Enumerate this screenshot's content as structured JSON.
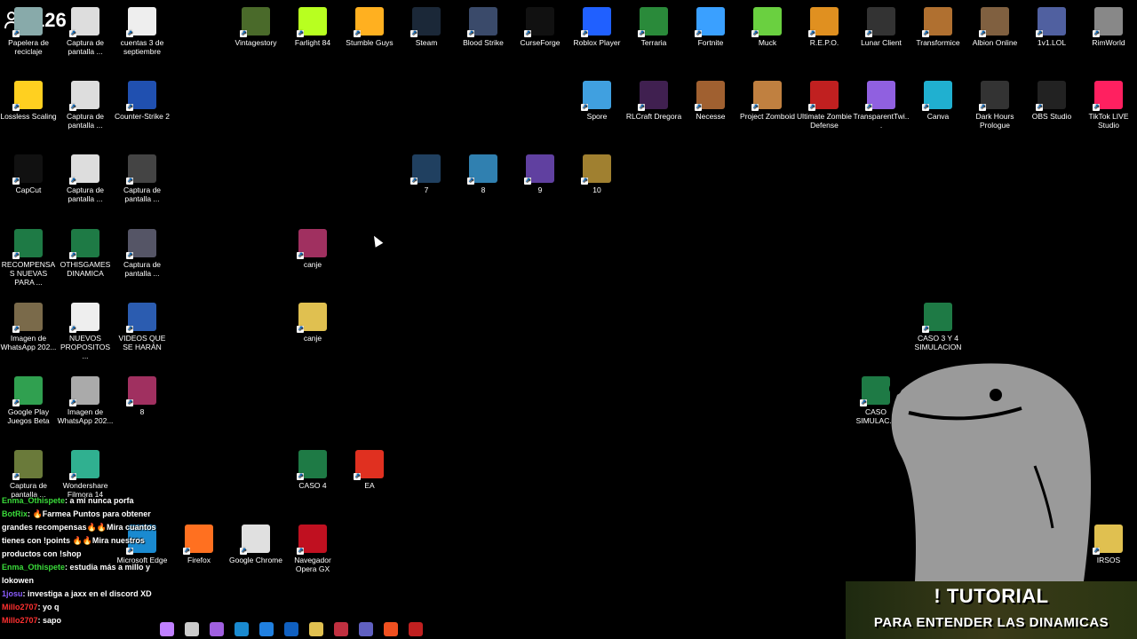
{
  "stream": {
    "viewer_count": "126",
    "banner_line1": "! TUTORIAL",
    "banner_line2": "PARA ENTENDER LAS DINAMICAS"
  },
  "desktop_icons": [
    {
      "label": "Papelera de reciclaje",
      "icon": "recycle-bin-icon",
      "color": "#8aa"
    },
    {
      "label": "Captura de pantalla ...",
      "icon": "screenshot-icon",
      "color": "#ddd"
    },
    {
      "label": "cuentas 3 de septiembre",
      "icon": "document-icon",
      "color": "#eee"
    },
    {
      "label": "Vintagestory",
      "icon": "tree-icon",
      "color": "#4a6a2a"
    },
    {
      "label": "Farlight 84",
      "icon": "farlight-icon",
      "color": "#b8ff20"
    },
    {
      "label": "Stumble Guys",
      "icon": "stumble-icon",
      "color": "#ffb020"
    },
    {
      "label": "Steam",
      "icon": "steam-icon",
      "color": "#1b2838"
    },
    {
      "label": "Blood Strike",
      "icon": "blood-strike-icon",
      "color": "#3a4a6a"
    },
    {
      "label": "CurseForge",
      "icon": "anvil-icon",
      "color": "#111"
    },
    {
      "label": "Roblox Player",
      "icon": "roblox-icon",
      "color": "#2060ff"
    },
    {
      "label": "Terraria",
      "icon": "terraria-icon",
      "color": "#2a8a3a"
    },
    {
      "label": "Fortnite",
      "icon": "fortnite-icon",
      "color": "#3aa0ff"
    },
    {
      "label": "Muck",
      "icon": "muck-icon",
      "color": "#6ad040"
    },
    {
      "label": "R.E.P.O.",
      "icon": "repo-icon",
      "color": "#e09020"
    },
    {
      "label": "Lunar Client",
      "icon": "lunar-icon",
      "color": "#333"
    },
    {
      "label": "Transformice",
      "icon": "mouse-icon",
      "color": "#b07030"
    },
    {
      "label": "Albion Online",
      "icon": "albion-icon",
      "color": "#806040"
    },
    {
      "label": "1v1.LOL",
      "icon": "1v1-icon",
      "color": "#5060a0"
    },
    {
      "label": "RimWorld",
      "icon": "rimworld-icon",
      "color": "#888"
    },
    {
      "label": "Lossless Scaling",
      "icon": "duck-icon",
      "color": "#ffd020"
    },
    {
      "label": "Captura de pantalla ...",
      "icon": "screenshot-icon",
      "color": "#ddd"
    },
    {
      "label": "Counter-Strike 2",
      "icon": "cs2-icon",
      "color": "#2050b0"
    },
    {
      "label": "Spore",
      "icon": "spore-icon",
      "color": "#40a0e0"
    },
    {
      "label": "RLCraft Dregora",
      "icon": "rlcraft-icon",
      "color": "#402050"
    },
    {
      "label": "Necesse",
      "icon": "necesse-icon",
      "color": "#a06030"
    },
    {
      "label": "Project Zomboid",
      "icon": "zomboid-icon",
      "color": "#c08040"
    },
    {
      "label": "Ultimate Zombie Defense",
      "icon": "uzd-icon",
      "color": "#c02020"
    },
    {
      "label": "TransparentTwi...",
      "icon": "chat-bubble-icon",
      "color": "#9060e0"
    },
    {
      "label": "Canva",
      "icon": "canva-icon",
      "color": "#20b0d0"
    },
    {
      "label": "Dark Hours Prologue",
      "icon": "dark-hours-icon",
      "color": "#333"
    },
    {
      "label": "OBS Studio",
      "icon": "obs-icon",
      "color": "#222"
    },
    {
      "label": "TikTok LIVE Studio",
      "icon": "tiktok-icon",
      "color": "#ff2060"
    },
    {
      "label": "CapCut",
      "icon": "capcut-icon",
      "color": "#111"
    },
    {
      "label": "Captura de pantalla ...",
      "icon": "screenshot-icon",
      "color": "#ddd"
    },
    {
      "label": "Captura de pantalla ...",
      "icon": "screenshot-icon",
      "color": "#444"
    },
    {
      "label": "7",
      "icon": "game-7-icon",
      "color": "#204060"
    },
    {
      "label": "8",
      "icon": "game-8-icon",
      "color": "#3080b0"
    },
    {
      "label": "9",
      "icon": "game-9-icon",
      "color": "#6040a0"
    },
    {
      "label": "10",
      "icon": "game-10-icon",
      "color": "#a08030"
    },
    {
      "label": "RECOMPENSAS NUEVAS PARA ...",
      "icon": "excel-icon",
      "color": "#1e7a45"
    },
    {
      "label": "OTHISGAMES DINAMICA",
      "icon": "excel-icon",
      "color": "#1e7a45"
    },
    {
      "label": "Captura de pantalla ...",
      "icon": "screenshot-icon",
      "color": "#556"
    },
    {
      "label": "canje",
      "icon": "winrar-icon",
      "color": "#a03060"
    },
    {
      "label": "Imagen de WhatsApp 202...",
      "icon": "image-icon",
      "color": "#7a6a4a"
    },
    {
      "label": "NUEVOS PROPOSITOS ...",
      "icon": "document-icon",
      "color": "#eee"
    },
    {
      "label": "VIDEOS QUE SE HARÁN",
      "icon": "word-icon",
      "color": "#2b5cb0"
    },
    {
      "label": "canje",
      "icon": "zip-folder-icon",
      "color": "#e0c050"
    },
    {
      "label": "CASO 3 Y 4 SIMULACION",
      "icon": "excel-icon",
      "color": "#1e7a45"
    },
    {
      "label": "Google Play Juegos Beta",
      "icon": "google-play-icon",
      "color": "#30a050"
    },
    {
      "label": "Imagen de WhatsApp 202...",
      "icon": "image-icon",
      "color": "#aaa"
    },
    {
      "label": "8",
      "icon": "winrar-icon",
      "color": "#a03060"
    },
    {
      "label": "CASO SIMULAC...",
      "icon": "excel-icon",
      "color": "#1e7a45"
    },
    {
      "label": "Captura de pantalla ...",
      "icon": "screenshot-icon",
      "color": "#6a7a3a"
    },
    {
      "label": "Wondershare Filmora 14",
      "icon": "filmora-icon",
      "color": "#30b090"
    },
    {
      "label": "CASO 4",
      "icon": "excel-icon",
      "color": "#1e7a45"
    },
    {
      "label": "EA",
      "icon": "ea-icon",
      "color": "#e03020"
    },
    {
      "label": "Microsoft Edge",
      "icon": "edge-icon",
      "color": "#1a8ad0"
    },
    {
      "label": "Firefox",
      "icon": "firefox-icon",
      "color": "#ff7020"
    },
    {
      "label": "Google Chrome",
      "icon": "chrome-icon",
      "color": "#e0e0e0"
    },
    {
      "label": "Navegador Opera GX",
      "icon": "opera-gx-icon",
      "color": "#c01020"
    },
    {
      "label": "IRSOS",
      "icon": "folder-icon",
      "color": "#e0c050"
    }
  ],
  "chat": [
    {
      "user": "Enma_Othispete",
      "user_class": "u-green",
      "text": ": a mí nunca porfa"
    },
    {
      "user": "BotRix",
      "user_class": "u-green",
      "text": ": 🔥Farmea Puntos para obtener grandes recompensas🔥🔥Mira cuantos tienes con !points 🔥🔥Mira nuestros productos con !shop"
    },
    {
      "user": "Enma_Othispete",
      "user_class": "u-green",
      "text": ": estudia más a millo y lokowen"
    },
    {
      "user": "1josu",
      "user_class": "u-purple",
      "text": ": investiga a jaxx en el discord XD"
    },
    {
      "user": "Millo2707",
      "user_class": "u-red",
      "text": ": yo q"
    },
    {
      "user": "Millo2707",
      "user_class": "u-red",
      "text": ": sapo"
    }
  ],
  "taskbar": [
    {
      "name": "copilot-icon",
      "color": "#c080ff"
    },
    {
      "name": "task-view-icon",
      "color": "#ccc"
    },
    {
      "name": "copilot-app-icon",
      "color": "#a060e0"
    },
    {
      "name": "edge-taskbar-icon",
      "color": "#1a8ad0"
    },
    {
      "name": "store-icon",
      "color": "#2080e0"
    },
    {
      "name": "outlook-icon",
      "color": "#1060c0"
    },
    {
      "name": "explorer-icon",
      "color": "#e0c050"
    },
    {
      "name": "game-taskbar-icon",
      "color": "#c03040"
    },
    {
      "name": "teams-icon",
      "color": "#6060c0"
    },
    {
      "name": "brave-icon",
      "color": "#f05020"
    },
    {
      "name": "obs-taskbar-icon",
      "color": "#c02020"
    }
  ]
}
